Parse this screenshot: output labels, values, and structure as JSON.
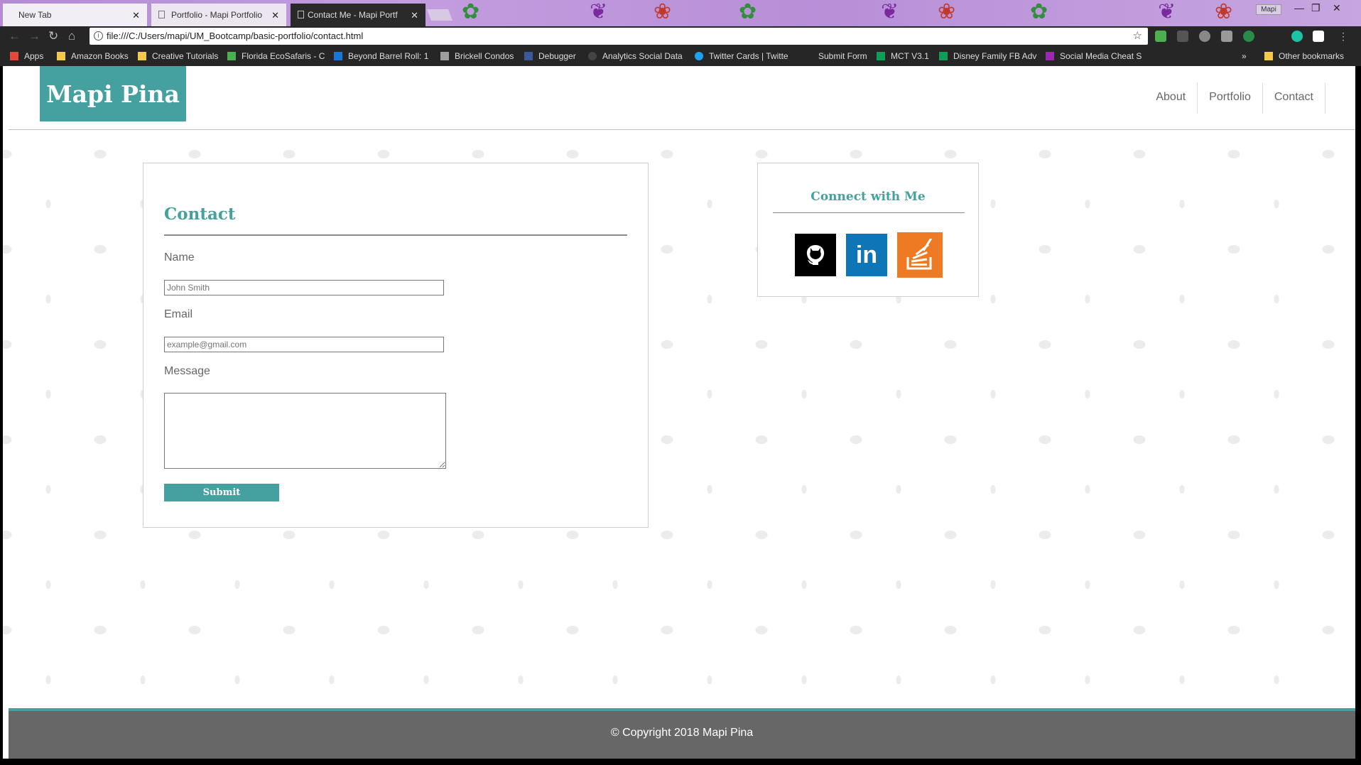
{
  "browser": {
    "tabs": [
      {
        "label": "New Tab"
      },
      {
        "label": "Portfolio - Mapi Portfolio"
      },
      {
        "label": "Contact Me - Mapi Portf"
      }
    ],
    "profile": "Mapi",
    "url": "file:///C:/Users/mapi/UM_Bootcamp/basic-portfolio/contact.html",
    "bookmarks": [
      {
        "label": "Apps",
        "icon": "apps-grid-icon",
        "color": "#e04a3a"
      },
      {
        "label": "Amazon Books",
        "icon": "folder-icon",
        "color": "#f2c94c"
      },
      {
        "label": "Creative Tutorials",
        "icon": "folder-icon",
        "color": "#f2c94c"
      },
      {
        "label": "Florida EcoSafaris - C",
        "icon": "palm-icon",
        "color": "#4caf50"
      },
      {
        "label": "Beyond Barrel Roll: 1",
        "icon": "site-icon",
        "color": "#1976d2"
      },
      {
        "label": "Brickell Condos",
        "icon": "site-icon",
        "color": "#9e9e9e"
      },
      {
        "label": "Debugger",
        "icon": "facebook-icon",
        "color": "#3b5998"
      },
      {
        "label": "Analytics Social Data",
        "icon": "circle-icon",
        "color": "#444444"
      },
      {
        "label": "Twitter Cards | Twitte",
        "icon": "twitter-icon",
        "color": "#1da1f2"
      },
      {
        "label": "Submit Form",
        "icon": "none",
        "color": "#262626"
      },
      {
        "label": "MCT V3.1",
        "icon": "sheet-icon",
        "color": "#0f9d58"
      },
      {
        "label": "Disney Family FB Adv",
        "icon": "sheet-icon",
        "color": "#0f9d58"
      },
      {
        "label": "Social Media Cheat S",
        "icon": "site-icon",
        "color": "#9c27b0"
      }
    ],
    "overflow": "»",
    "other_bookmarks": "Other bookmarks"
  },
  "site": {
    "brand": "Mapi Pina",
    "nav": [
      "About",
      "Portfolio",
      "Contact"
    ],
    "contact": {
      "title": "Contact",
      "name_label": "Name",
      "name_placeholder": "John Smith",
      "email_label": "Email",
      "email_placeholder": "example@gmail.com",
      "message_label": "Message",
      "submit_label": "Submit"
    },
    "social": {
      "title": "Connect with Me",
      "links": [
        "github-icon",
        "linkedin-icon",
        "stackoverflow-icon"
      ],
      "linkedin_text": "in"
    },
    "footer": "© Copyright 2018 Mapi Pina",
    "colors": {
      "accent": "#45a0a0",
      "footer": "#676767"
    }
  }
}
